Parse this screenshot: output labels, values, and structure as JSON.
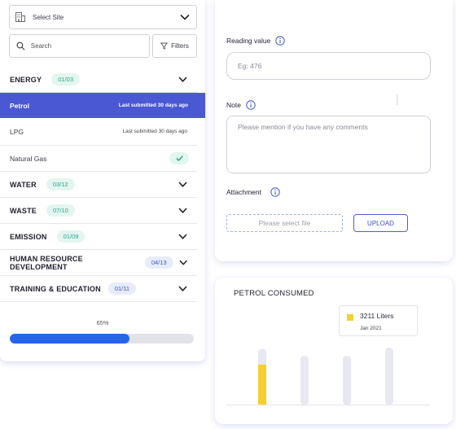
{
  "sidebar": {
    "site_select_label": "Select Site",
    "search_placeholder": "Search",
    "filters_label": "Filters",
    "categories": [
      {
        "name": "ENERGY",
        "badge": "01/03"
      },
      {
        "name": "WATER",
        "badge": "03/12"
      },
      {
        "name": "WASTE",
        "badge": "07/10"
      },
      {
        "name": "EMISSION",
        "badge": "01/09"
      },
      {
        "name": "HUMAN RESOURCE DEVELOPMENT",
        "badge": "04/13"
      },
      {
        "name": "TRAINING & EDUCATION",
        "badge": "01/11"
      }
    ],
    "energy_items": [
      {
        "name": "Petrol",
        "status": "Last submitted 30 days ago",
        "active": true
      },
      {
        "name": "LPG",
        "status": "Last submitted 30 days ago",
        "active": false
      },
      {
        "name": "Natural Gas",
        "status": "",
        "completed": true
      }
    ],
    "progress": {
      "label": "65%",
      "value": 0.65
    }
  },
  "form": {
    "reading_label": "Reading value",
    "reading_placeholder": "Eg: 476",
    "note_label": "Note",
    "note_placeholder": "Please mention if you have any comments",
    "attachment_label": "Attachment",
    "file_placeholder": "Please select file",
    "upload_label": "UPLOAD"
  },
  "chart_data": {
    "type": "bar",
    "title": "PETROL CONSUMED",
    "categories": [
      "",
      "",
      "",
      ""
    ],
    "series": [
      {
        "values": [
          3211,
          null,
          null,
          null
        ]
      }
    ],
    "highlighted_index": 0,
    "tooltip": {
      "value": "3211 Liters",
      "date": "Jan 2021"
    },
    "colors": {
      "filled": "#f6cf2f",
      "track": "#e8e8f3"
    },
    "ylim": [
      0,
      4700
    ]
  },
  "colors": {
    "accent": "#4a58d4",
    "progress": "#2664eb",
    "badge_bg": "#e3f6f0",
    "badge_text": "#2ca58d"
  }
}
